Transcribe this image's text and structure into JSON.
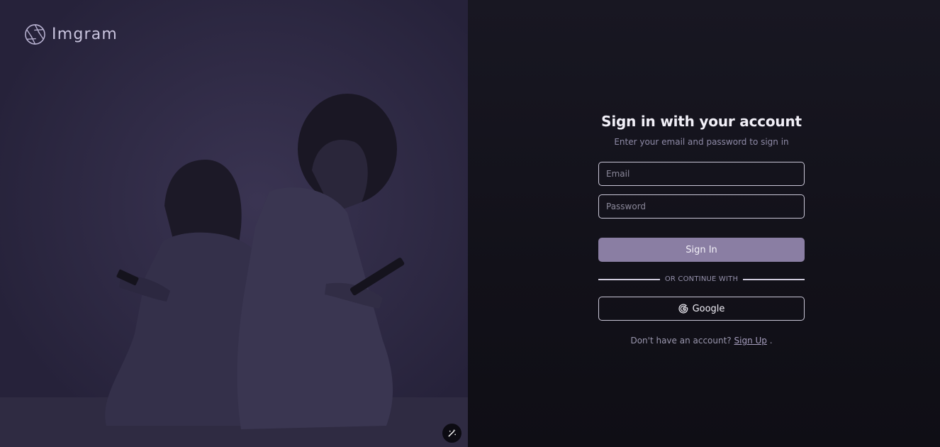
{
  "brand": {
    "name": "Imgram",
    "logo_icon": "aperture-icon"
  },
  "hero": {
    "wand_icon": "magic-wand-icon"
  },
  "signin": {
    "title": "Sign in with your account",
    "subtitle": "Enter your email and password to sign in",
    "email_placeholder": "Email",
    "password_placeholder": "Password",
    "submit_label": "Sign In",
    "divider_label": "OR CONTINUE WITH",
    "google_label": "Google",
    "signup_prompt": "Don't have an account?",
    "signup_link": "Sign Up",
    "signup_suffix": "."
  },
  "colors": {
    "left_panel": "#27233a",
    "right_panel": "#13121a",
    "accent_button": "#8a7ea3"
  }
}
